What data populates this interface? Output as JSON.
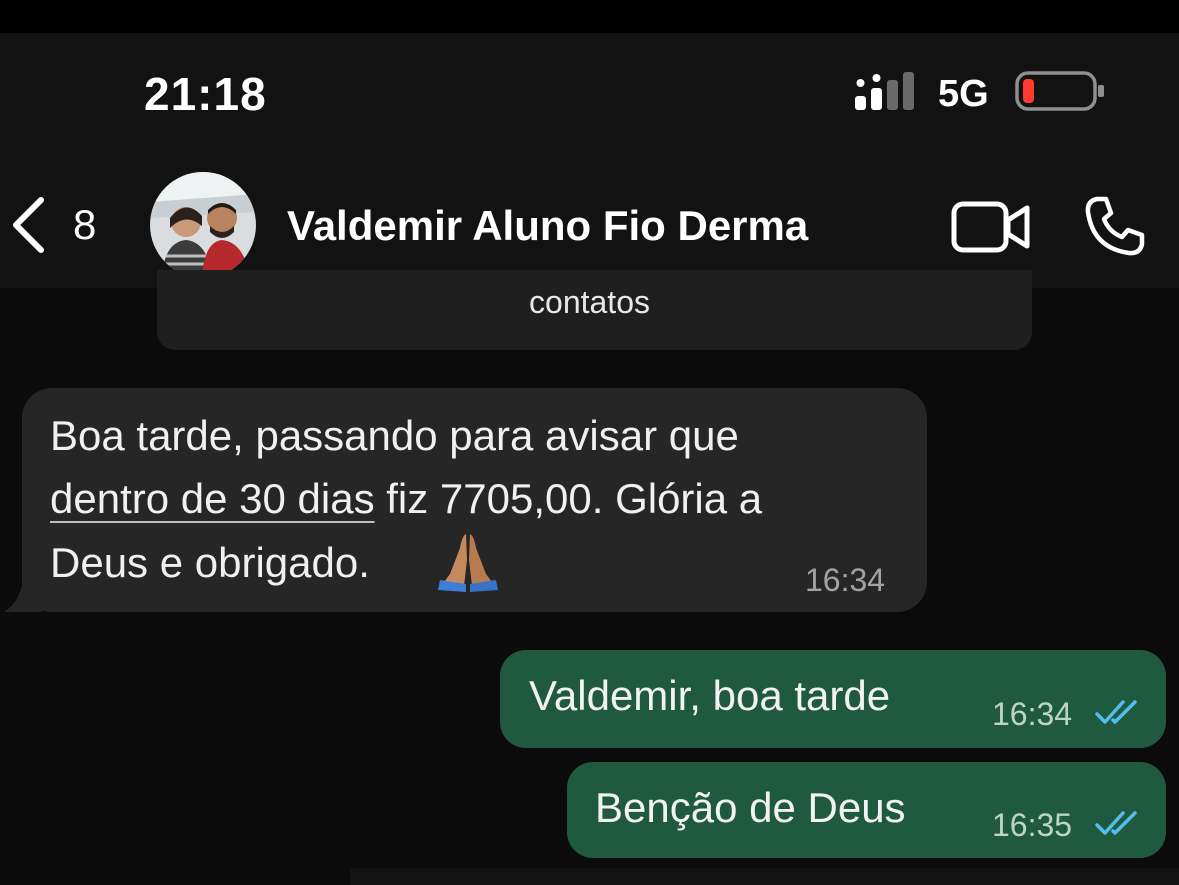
{
  "status_bar": {
    "time": "21:18",
    "network": "5G",
    "battery_level": "low",
    "signal_icon": "cellular-signal-icon",
    "battery_icon": "battery-low-icon"
  },
  "header": {
    "back_count": "8",
    "contact_name": "Valdemir Aluno Fio Derma",
    "icons": [
      "back-chevron-icon",
      "video-call-icon",
      "phone-call-icon"
    ]
  },
  "system_message": {
    "text": "contatos"
  },
  "messages": [
    {
      "direction": "incoming",
      "lines": [
        "Boa tarde, passando para avisar que",
        "dentro de 30 dias",
        " fiz 7705,00. Glória a",
        "Deus e obrigado."
      ],
      "emoji": "folded-hands-emoji",
      "time": "16:34"
    },
    {
      "direction": "outgoing",
      "text": "Valdemir, boa tarde",
      "time": "16:34",
      "status": "read"
    },
    {
      "direction": "outgoing",
      "text": "Benção de Deus",
      "time": "16:35",
      "status": "read"
    }
  ],
  "colors": {
    "background": "#0b0b0b",
    "header": "#121212",
    "incoming_bubble": "#262626",
    "outgoing_bubble": "#1f5a40",
    "read_ticks": "#53bdeb",
    "battery_low": "#ff3b30"
  }
}
